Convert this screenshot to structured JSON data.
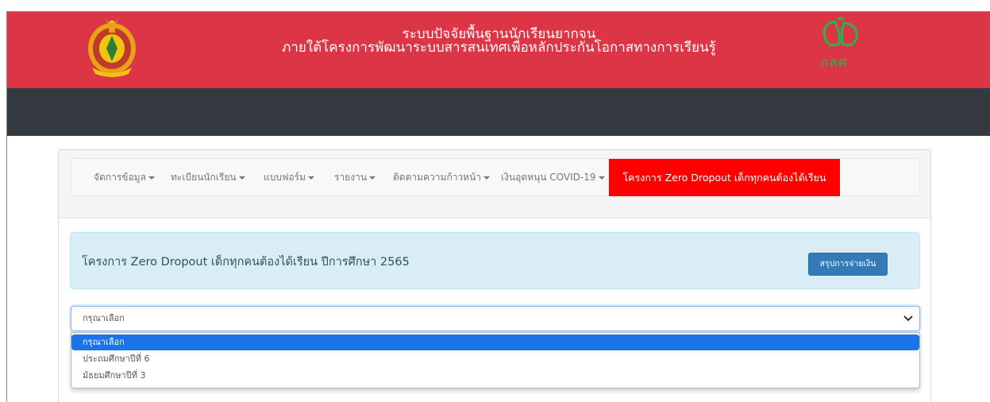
{
  "header": {
    "line1": "ระบบปัจจัยพื้นฐานนักเรียนยากจน",
    "line2": "ภายใต้โครงการพัฒนาระบบสารสนเทศเพื่อหลักประกันโอกาสทางการเรียนรู้",
    "logo_text": "กสศ",
    "band_color": "#dc3545",
    "dark_band_color": "#343a40"
  },
  "nav": {
    "items": [
      {
        "label": "จัดการข้อมูล"
      },
      {
        "label": "ทะเบียนนักเรียน"
      },
      {
        "label": "แบบฟอร์ม"
      },
      {
        "label": "รายงาน"
      },
      {
        "label": "ติดตามความก้าวหน้า"
      },
      {
        "label": "เงินอุดหนุน COVID-19"
      }
    ],
    "active": "โครงการ Zero Dropout เด็กทุกคนต้องได้เรียน",
    "active_color": "#ff0000"
  },
  "alert": {
    "title": "โครงการ Zero Dropout เด็กทุกคนต้องได้เรียน ปีการศึกษา 2565",
    "button": "สรุปการจ่ายเงิน"
  },
  "select": {
    "value": "กรุณาเลือก",
    "options": [
      "กรุณาเลือก",
      "ประถมศึกษาปีที่ 6",
      "มัธยมศึกษาปีที่ 3"
    ]
  },
  "icons": [
    "obec-seal-icon",
    "tsqp-logo-icon",
    "caret-down-icon",
    "chevron-down-icon"
  ]
}
